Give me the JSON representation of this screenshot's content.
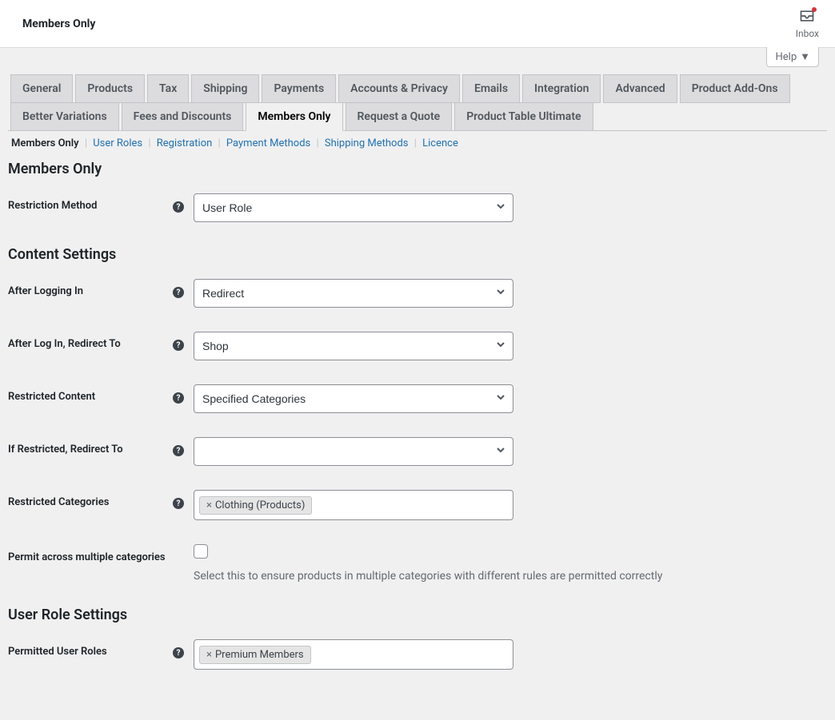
{
  "topBar": {
    "title": "Members Only",
    "inbox": "Inbox"
  },
  "help": "Help",
  "tabs": {
    "row1": [
      "General",
      "Products",
      "Tax",
      "Shipping",
      "Payments",
      "Accounts & Privacy",
      "Emails",
      "Integration",
      "Advanced",
      "Product Add-Ons"
    ],
    "row2": [
      "Better Variations",
      "Fees and Discounts",
      "Members Only",
      "Request a Quote",
      "Product Table Ultimate"
    ],
    "activeIndex": 2
  },
  "subsub": {
    "items": [
      "Members Only",
      "User Roles",
      "Registration",
      "Payment Methods",
      "Shipping Methods",
      "Licence"
    ],
    "activeIndex": 0
  },
  "sections": {
    "s1": "Members Only",
    "s2": "Content Settings",
    "s3": "User Role Settings"
  },
  "fields": {
    "restrictionMethod": {
      "label": "Restriction Method",
      "value": "User Role"
    },
    "afterLoggingIn": {
      "label": "After Logging In",
      "value": "Redirect"
    },
    "afterLogInRedirect": {
      "label": "After Log In, Redirect To",
      "value": "Shop"
    },
    "restrictedContent": {
      "label": "Restricted Content",
      "value": "Specified Categories"
    },
    "ifRestrictedRedirect": {
      "label": "If Restricted, Redirect To",
      "value": ""
    },
    "restrictedCategories": {
      "label": "Restricted Categories",
      "tag": "Clothing (Products)"
    },
    "permitMultiple": {
      "label": "Permit across multiple categories",
      "desc": "Select this to ensure products in multiple categories with different rules are permitted correctly"
    },
    "permittedRoles": {
      "label": "Permitted User Roles",
      "tag": "Premium Members"
    }
  }
}
